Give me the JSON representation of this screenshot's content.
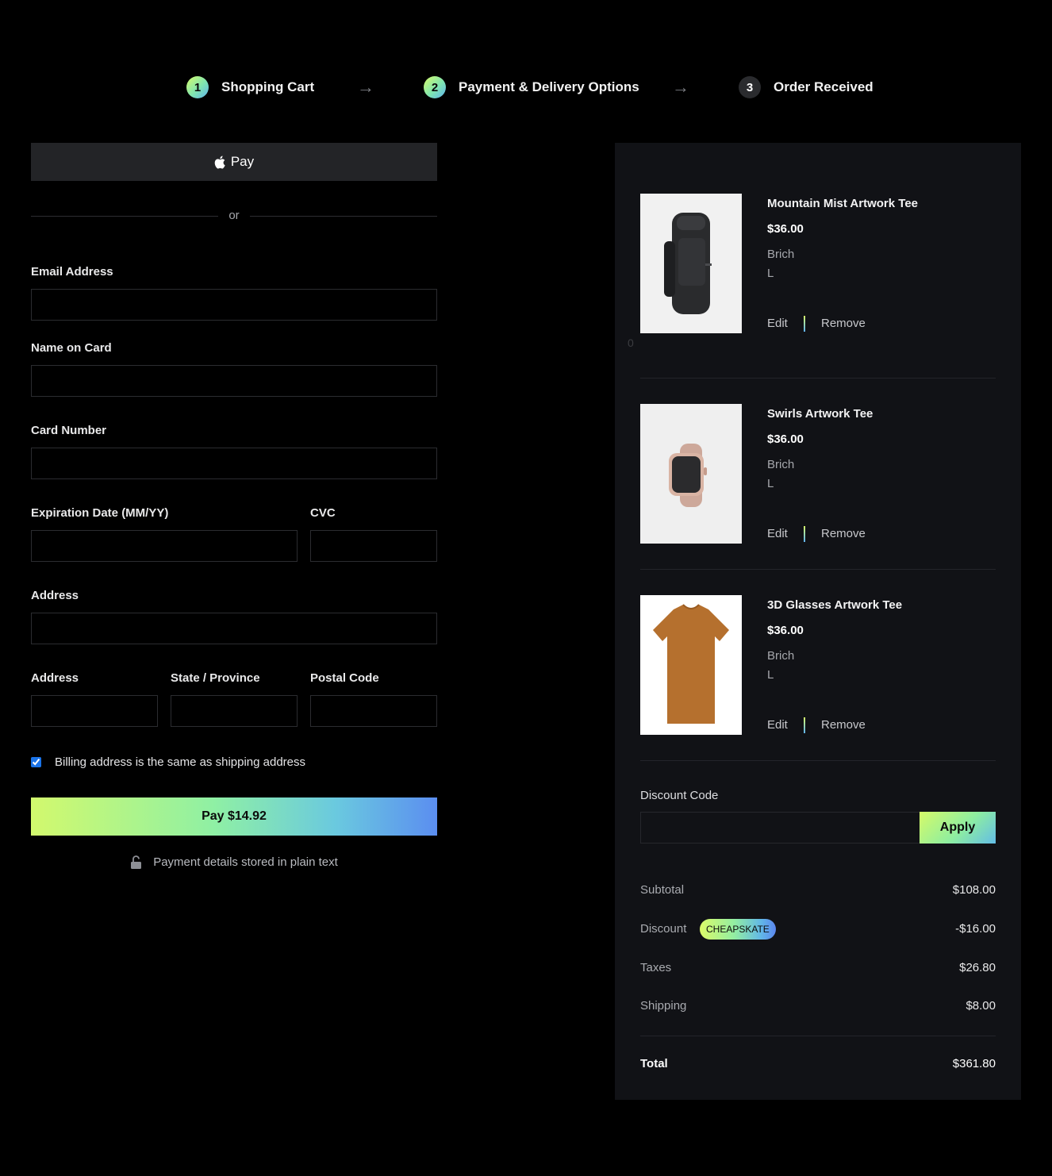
{
  "stepper": {
    "steps": [
      {
        "number": "1",
        "label": "Shopping Cart",
        "state": "complete"
      },
      {
        "number": "2",
        "label": "Payment & Delivery Options",
        "state": "complete"
      },
      {
        "number": "3",
        "label": "Order Received",
        "state": "current"
      }
    ],
    "arrow_icon": "arrow-right-icon"
  },
  "payment": {
    "apple_pay_label": "Pay",
    "or_text": "or",
    "fields": {
      "email": {
        "label": "Email Address",
        "value": ""
      },
      "name_on_card": {
        "label": "Name on Card",
        "value": ""
      },
      "card_number": {
        "label": "Card Number",
        "value": ""
      },
      "expiration": {
        "label": "Expiration Date (MM/YY)",
        "value": ""
      },
      "cvc": {
        "label": "CVC",
        "value": ""
      },
      "address": {
        "label": "Address",
        "value": ""
      },
      "city": {
        "label": "Address",
        "value": ""
      },
      "state": {
        "label": "State / Province",
        "value": ""
      },
      "postal": {
        "label": "Postal Code",
        "value": ""
      }
    },
    "billing_same": {
      "label": "Billing address is the same as shipping address",
      "checked": true
    },
    "pay_button": "Pay $14.92",
    "secure_note": "Payment details stored in plain text"
  },
  "cart": {
    "stray_text": "0",
    "items": [
      {
        "name": "Mountain Mist Artwork Tee",
        "price": "$36.00",
        "color": "Brich",
        "size": "L",
        "image": "backpack",
        "edit_label": "Edit",
        "remove_label": "Remove"
      },
      {
        "name": "Swirls Artwork Tee",
        "price": "$36.00",
        "color": "Brich",
        "size": "L",
        "image": "watch",
        "edit_label": "Edit",
        "remove_label": "Remove"
      },
      {
        "name": "3D Glasses Artwork Tee",
        "price": "$36.00",
        "color": "Brich",
        "size": "L",
        "image": "tshirt",
        "edit_label": "Edit",
        "remove_label": "Remove"
      }
    ],
    "discount": {
      "label": "Discount Code",
      "value": "",
      "apply_label": "Apply"
    },
    "summary": {
      "subtotal": {
        "label": "Subtotal",
        "value": "$108.00"
      },
      "discount": {
        "label": "Discount",
        "code": "CHEAPSKATE",
        "value": "-$16.00"
      },
      "taxes": {
        "label": "Taxes",
        "value": "$26.80"
      },
      "shipping": {
        "label": "Shipping",
        "value": "$8.00"
      },
      "total": {
        "label": "Total",
        "value": "$361.80"
      }
    }
  },
  "colors": {
    "accent_gradient_start": "#d8fb6a",
    "accent_gradient_mid": "#8ff0a4",
    "accent_gradient_end": "#5b8ef0",
    "background": "#000000",
    "panel": "#111216"
  }
}
